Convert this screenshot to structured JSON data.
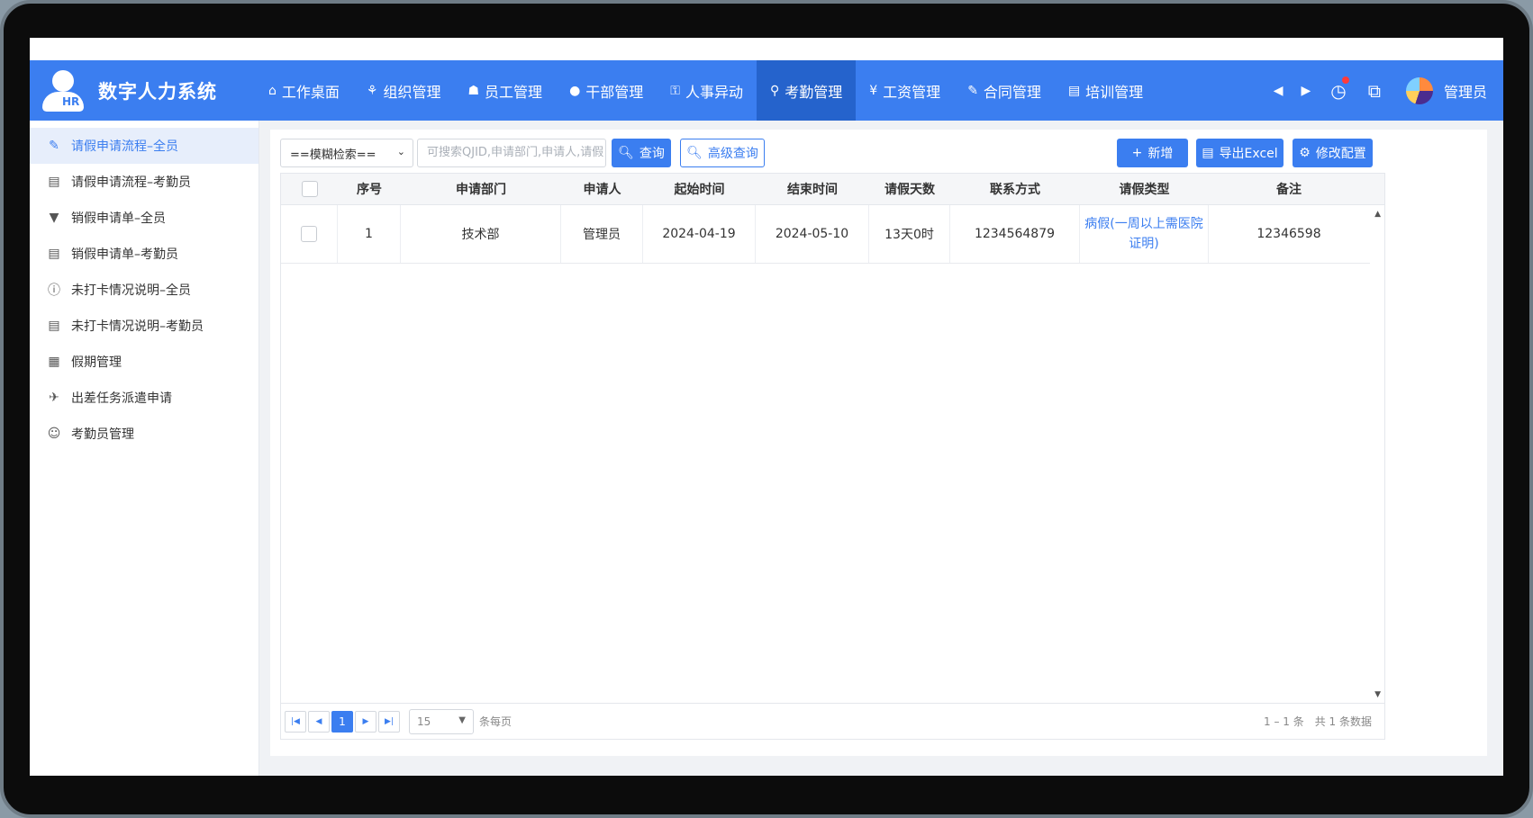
{
  "app": {
    "title": "数字人力系统",
    "logo_text": "HR"
  },
  "nav": {
    "items": [
      {
        "icon": "⌂",
        "label": "工作桌面"
      },
      {
        "icon": "⚘",
        "label": "组织管理"
      },
      {
        "icon": "☗",
        "label": "员工管理"
      },
      {
        "icon": "●",
        "label": "干部管理"
      },
      {
        "icon": "⚿",
        "label": "人事异动"
      },
      {
        "icon": "⚲",
        "label": "考勤管理"
      },
      {
        "icon": "¥",
        "label": "工资管理"
      },
      {
        "icon": "✎",
        "label": "合同管理"
      },
      {
        "icon": "▤",
        "label": "培训管理"
      }
    ],
    "active_index": 5,
    "user": "管理员"
  },
  "sidebar": {
    "items": [
      {
        "icon": "✎",
        "label": "请假申请流程–全员"
      },
      {
        "icon": "▤",
        "label": "请假申请流程–考勤员"
      },
      {
        "icon": "▼",
        "label": "销假申请单–全员"
      },
      {
        "icon": "▤",
        "label": "销假申请单–考勤员"
      },
      {
        "icon": "ⓘ",
        "label": "未打卡情况说明–全员"
      },
      {
        "icon": "▤",
        "label": "未打卡情况说明–考勤员"
      },
      {
        "icon": "▦",
        "label": "假期管理"
      },
      {
        "icon": "✈",
        "label": "出差任务派遣申请"
      },
      {
        "icon": "☺",
        "label": "考勤员管理"
      }
    ],
    "active_index": 0
  },
  "toolbar": {
    "select_value": "==模糊检索==",
    "search_placeholder": "可搜索QJID,申请部门,申请人,请假",
    "query_label": "查询",
    "advanced_label": "高级查询",
    "add_label": "新增",
    "export_label": "导出Excel",
    "config_label": "修改配置"
  },
  "table": {
    "columns": [
      "序号",
      "申请部门",
      "申请人",
      "起始时间",
      "结束时间",
      "请假天数",
      "联系方式",
      "请假类型",
      "备注"
    ],
    "rows": [
      [
        "1",
        "技术部",
        "管理员",
        "2024-04-19",
        "2024-05-10",
        "13天0时",
        "1234564879",
        "病假(一周以上需医院证明)",
        "12346598"
      ]
    ]
  },
  "pager": {
    "current_page": "1",
    "page_size": "15",
    "per_page_label": "条每页",
    "range_text": "1 – 1 条",
    "total_text": "共 1 条数据"
  }
}
